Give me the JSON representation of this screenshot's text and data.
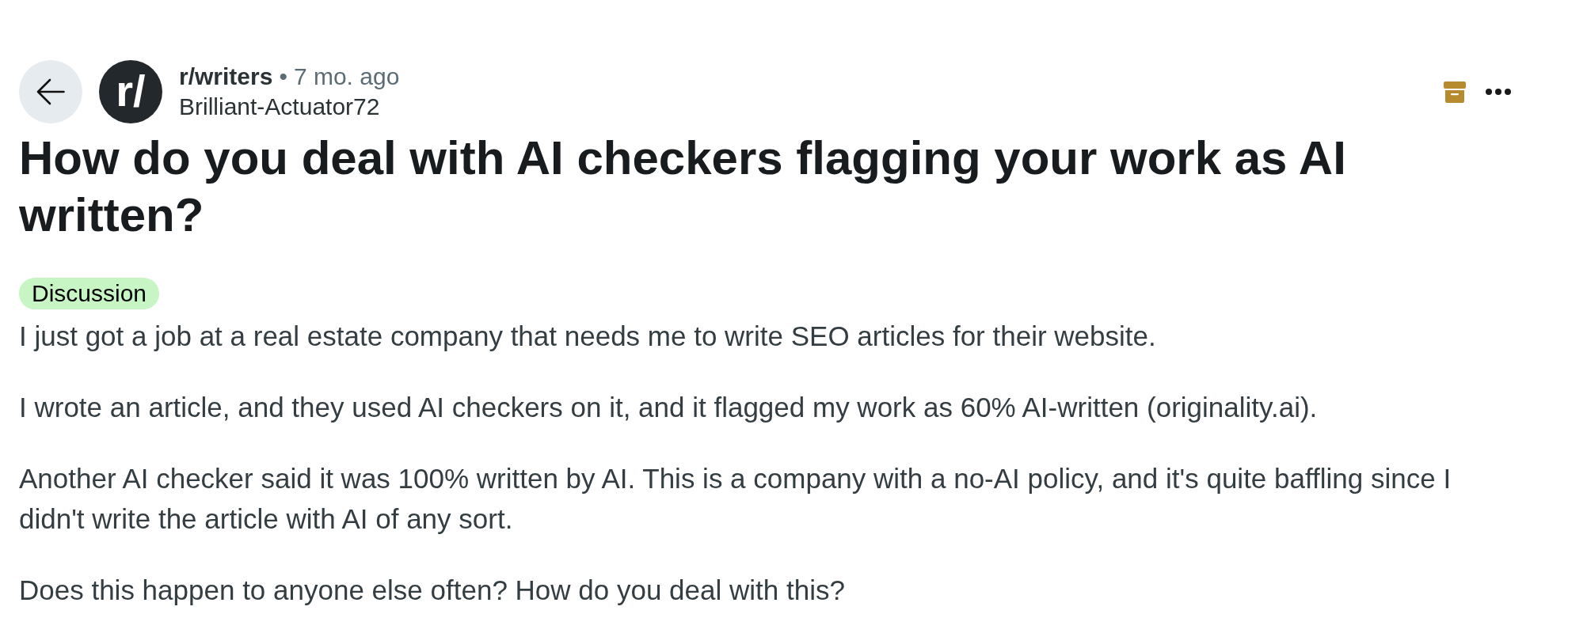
{
  "post": {
    "community_icon_text": "r/",
    "community": "r/writers",
    "separator": "•",
    "time": "7 mo. ago",
    "author": "Brilliant-Actuator72",
    "archived": true
  },
  "title": "How do you deal with AI checkers flagging your work as AI written?",
  "flair": "Discussion",
  "body": [
    "I just got a job at a real estate company that needs me to write SEO articles for their website.",
    "I wrote an article, and they used AI checkers on it, and it flagged my work as 60% AI-written (originality.ai).",
    "Another AI checker said it was 100% written by AI. This is a company with a no-AI policy, and it's quite baffling since I didn't write the article with AI of any sort.",
    "Does this happen to anyone else often? How do you deal with this?"
  ]
}
